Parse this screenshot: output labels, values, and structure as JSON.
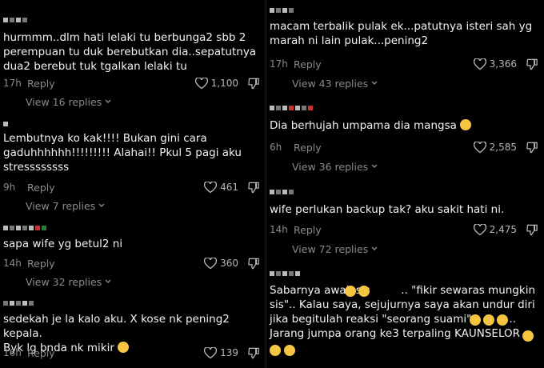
{
  "left_column": [
    {
      "text": "hurmmm..dlm hati lelaki tu berbunga2 sbb 2\nperempuan tu duk berebutkan dia..sepatutnya\ndua2 berebut tuk tgalkan lelaki tu",
      "time": "17h",
      "reply": "Reply",
      "likes": "1,100",
      "view_replies": "View 16 replies"
    },
    {
      "text": "Lembutnya ko kak!!!! Bukan gini cara\ngaduhhhhhh!!!!!!!!! Alahai!! Pkul 5 pagi aku\nstressssssss",
      "time": "9h",
      "reply": "Reply",
      "likes": "461",
      "view_replies": "View 7 replies"
    },
    {
      "text": "sapa wife yg betul2 ni",
      "time": "14h",
      "reply": "Reply",
      "likes": "360",
      "view_replies": "View 32 replies"
    },
    {
      "text": "sedekah je la kalo aku. X kose nk pening2 kepala.\nByk lg bnda nk mikir",
      "time": "16h",
      "reply": "Reply",
      "likes": "139",
      "view_replies": ""
    }
  ],
  "right_column": [
    {
      "text": "macam terbalik pulak ek...patutnya isteri sah yg\nmarah ni lain pulak...pening2",
      "time": "17h",
      "reply": "Reply",
      "likes": "3,366",
      "view_replies": "View 43 replies"
    },
    {
      "text": "Dia berhujah umpama dia mangsa",
      "time": "6h",
      "reply": "Reply",
      "likes": "2,585",
      "view_replies": "View 36 replies"
    },
    {
      "text": "wife perlukan backup tak? aku sakit hati ni.",
      "time": "14h",
      "reply": "Reply",
      "likes": "2,475",
      "view_replies": "View 72 replies"
    },
    {
      "text": "Sabarnya awak sis         .. \"fikir sewaras mungkin\nsis\".. Kalau saya, sejujurnya saya akan undur diri\njika begitulah reaksi \"seorang suami\"           ..\nJarang jumpa orang ke3 terpaling KAUNSELOR",
      "time": "",
      "reply": "",
      "likes": "",
      "view_replies": ""
    }
  ],
  "icons": {
    "like": "heart-outline-icon",
    "dislike": "thumbs-down-icon",
    "chevron": "chevron-down-icon"
  },
  "colors": {
    "background": "#000000",
    "text": "#f2f2f2",
    "meta": "#8a8a8a"
  }
}
